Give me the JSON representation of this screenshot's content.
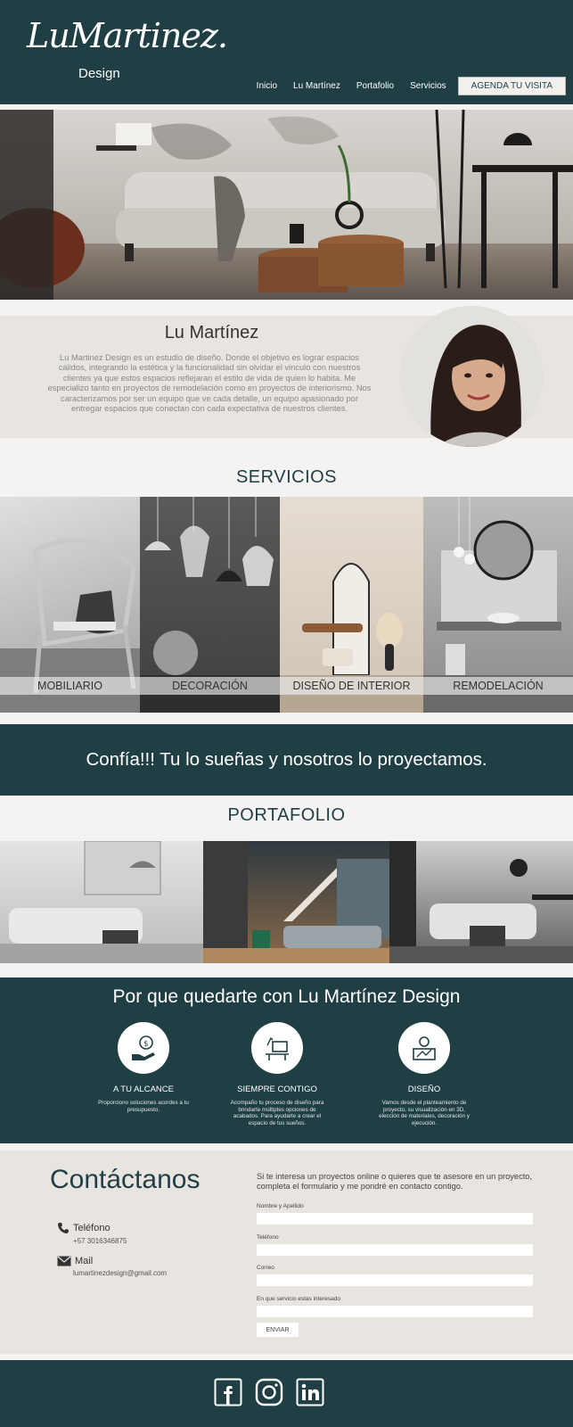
{
  "brand": {
    "logo_script": "LuMartinez.",
    "logo_sub": "Design"
  },
  "nav": {
    "items": [
      "Inicio",
      "Lu Martínez",
      "Portafolio",
      "Servicios"
    ],
    "cta": "AGENDA TU VISITA"
  },
  "about": {
    "title": "Lu Martínez",
    "text": "Lu Martinez Design es un estudio de diseño. Donde el objetivo es lograr espacios cálidos, integrando la estética y la funcionalidad sin olvidar el vinculo con nuestros clientes ya que estos espacios reflejaran el estilo de vida de quien lo habita. Me especializo tanto en proyectos de remodelación como en proyectos de interiorismo. Nos caracterizamos por ser un equipo que ve cada detalle, un equipo apasionado por entregar espacios que conectan con cada expectativa de nuestros clientes."
  },
  "services": {
    "title": "SERVICIOS",
    "items": [
      "MOBILIARIO",
      "DECORACIÓN",
      "DISEÑO DE INTERIOR",
      "REMODELACIÓN"
    ]
  },
  "banner": {
    "text": "Confía!!! Tu lo sueñas y nosotros lo proyectamos."
  },
  "portfolio": {
    "title": "PORTAFOLIO"
  },
  "why": {
    "title": "Por que quedarte con Lu Martínez Design",
    "features": [
      {
        "title": "A TU ALCANCE",
        "text": "Proporciono soluciones acordes a tu presupuesto.",
        "icon": "money-hand-icon"
      },
      {
        "title": "SIEMPRE CONTIGO",
        "text": "Acompaño tu proceso de diseño para brindarte múltiples opciones de acabados. Para ayudarte a crear el espacio de tus sueños.",
        "icon": "workspace-icon"
      },
      {
        "title": "DISEÑO",
        "text": "Vamos desde el planteamiento de proyecto, su visualización en 3D, elección de materiales, decoración y ejecución.",
        "icon": "design-tools-icon"
      }
    ]
  },
  "contact": {
    "title": "Contáctanos",
    "intro": "Si te interesa un proyectos online o quieres que te asesore en un proyecto, completa el formulario y me pondré en contacto contigo.",
    "phone_label": "Teléfono",
    "phone": "+57 3016346875",
    "mail_label": "Mail",
    "mail": "lumartinezdesign@gmail.com",
    "fields": [
      "Nombre y Apellido",
      "Teléfono",
      "Correo",
      "En que servicio estas interesado"
    ],
    "send": "ENVIAR"
  },
  "footer": {
    "social": [
      "facebook-icon",
      "instagram-icon",
      "linkedin-icon"
    ]
  },
  "colors": {
    "primary": "#1f3f45",
    "light": "#e8e4df",
    "background": "#f4f3f1"
  }
}
